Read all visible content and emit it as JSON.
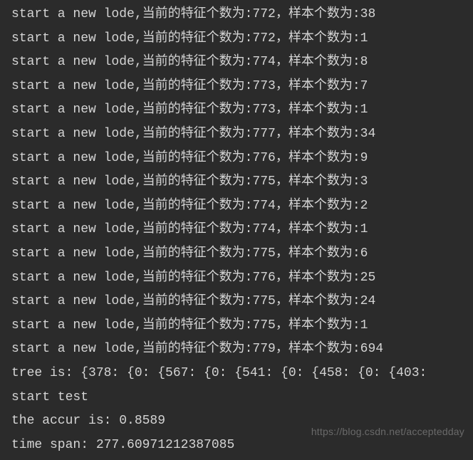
{
  "log": {
    "prefix": "start a new lode,当前的特征个数为:",
    "mid": "，样本个数为:",
    "lines": [
      {
        "features": 772,
        "samples": 38
      },
      {
        "features": 772,
        "samples": 1
      },
      {
        "features": 774,
        "samples": 8
      },
      {
        "features": 773,
        "samples": 7
      },
      {
        "features": 773,
        "samples": 1
      },
      {
        "features": 777,
        "samples": 34
      },
      {
        "features": 776,
        "samples": 9
      },
      {
        "features": 775,
        "samples": 3
      },
      {
        "features": 774,
        "samples": 2
      },
      {
        "features": 774,
        "samples": 1
      },
      {
        "features": 775,
        "samples": 6
      },
      {
        "features": 776,
        "samples": 25
      },
      {
        "features": 775,
        "samples": 24
      },
      {
        "features": 775,
        "samples": 1
      },
      {
        "features": 779,
        "samples": 694
      }
    ]
  },
  "tree_line": "tree is: {378: {0: {567: {0: {541: {0: {458: {0: {403:",
  "start_test": "start test",
  "accur_label": "the accur is: ",
  "accur_value": "0.8589",
  "time_label": "time span: ",
  "time_value": "277.60971212387085",
  "watermark": "https://blog.csdn.net/acceptedday"
}
